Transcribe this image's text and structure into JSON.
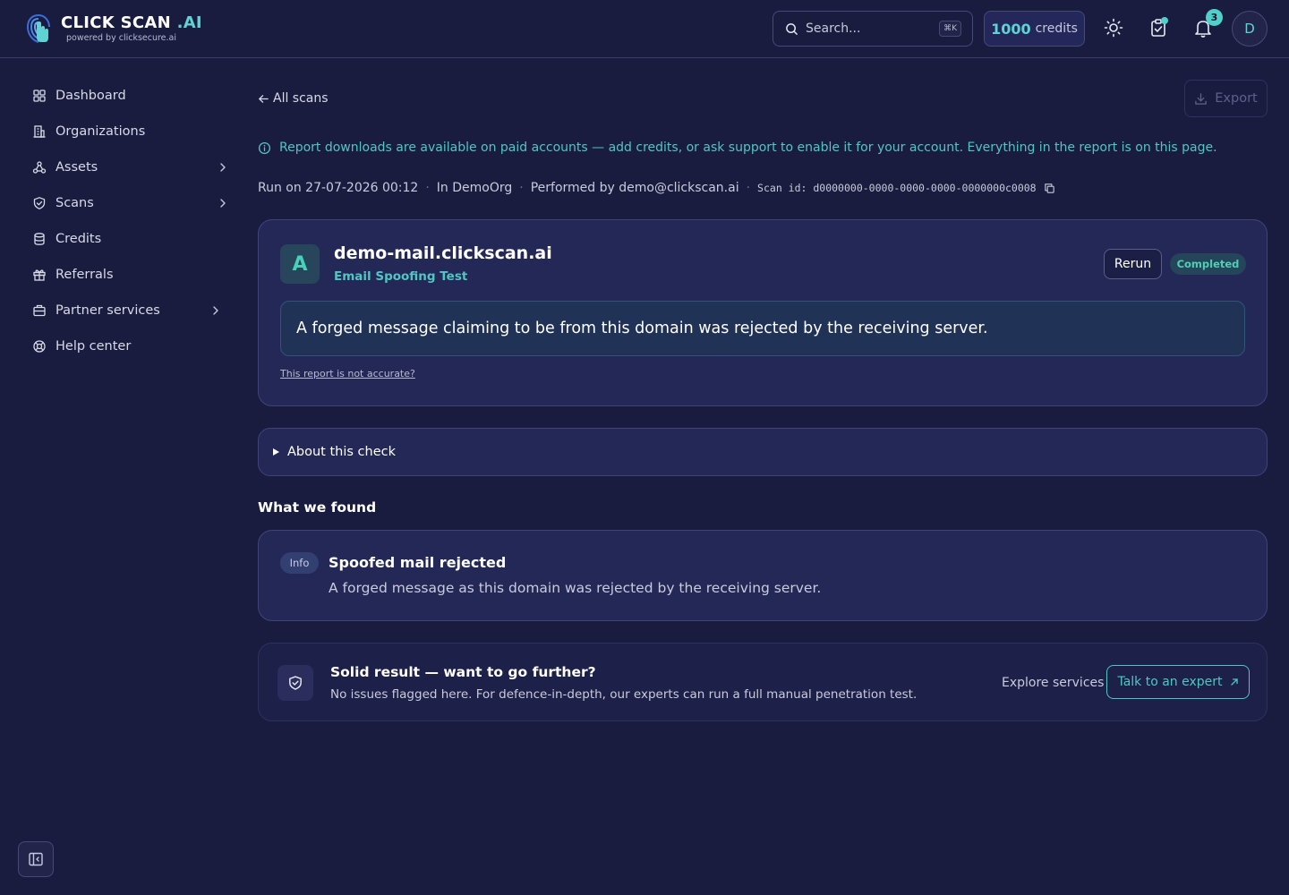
{
  "header": {
    "logo_title": "CLICK SCAN",
    "logo_title_accent": ".AI",
    "logo_subtitle": "powered by clicksecure.ai",
    "search_placeholder": "Search...",
    "search_shortcut": "⌘K",
    "credits_amount": "1000",
    "credits_label": "credits",
    "notification_count": "3",
    "avatar_initial": "D"
  },
  "sidebar": {
    "items": [
      {
        "label": "Dashboard",
        "icon": "grid-icon"
      },
      {
        "label": "Organizations",
        "icon": "building-icon"
      },
      {
        "label": "Assets",
        "icon": "nodes-icon",
        "has_chevron": true
      },
      {
        "label": "Scans",
        "icon": "shield-icon",
        "has_chevron": true
      },
      {
        "label": "Credits",
        "icon": "database-icon"
      },
      {
        "label": "Referrals",
        "icon": "gift-icon"
      },
      {
        "label": "Partner services",
        "icon": "briefcase-icon",
        "has_chevron": true
      },
      {
        "label": "Help center",
        "icon": "lifebuoy-icon"
      }
    ]
  },
  "main": {
    "back_label": "All scans",
    "export_label": "Export",
    "notice": "Report downloads are available on paid accounts — add credits, or ask support to enable it for your account. Everything in the report is on this page.",
    "meta": {
      "run_on": "Run on 27-07-2026 00:12",
      "org": "In DemoOrg",
      "performed_by": "Performed by demo@clickscan.ai",
      "scan_id": "Scan id: d0000000-0000-0000-0000-0000000c0008"
    },
    "result": {
      "grade": "A",
      "domain": "demo-mail.clickscan.ai",
      "test_name": "Email Spoofing Test",
      "rerun_label": "Rerun",
      "status": "Completed",
      "summary": "A forged message claiming to be from this domain was rejected by the receiving server.",
      "inaccurate_link": "This report is not accurate?"
    },
    "about_label": "About this check",
    "findings_title": "What we found",
    "finding": {
      "severity": "Info",
      "title": "Spoofed mail rejected",
      "description": "A forged message as this domain was rejected by the receiving server."
    },
    "cta": {
      "title": "Solid result — want to go further?",
      "description": "No issues flagged here. For defence-in-depth, our experts can run a full manual penetration test.",
      "explore_label": "Explore services",
      "expert_label": "Talk to an expert"
    }
  },
  "colors": {
    "background": "#1a1c3f",
    "accent": "#4fc6c2",
    "card": "#242857"
  }
}
